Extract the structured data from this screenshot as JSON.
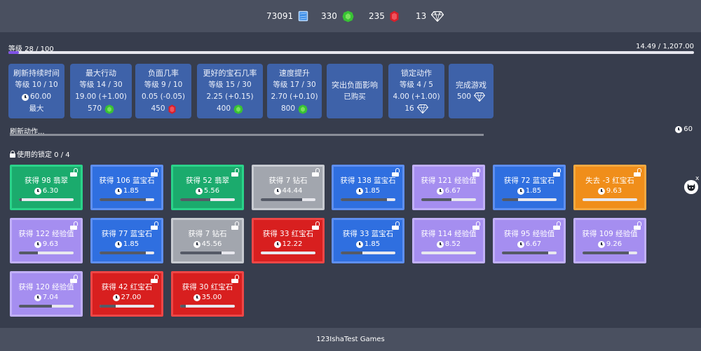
{
  "resources": [
    {
      "name": "time-crystal",
      "value": "73091",
      "color": "#3f8fe8",
      "icon": "blue-gem-icon"
    },
    {
      "name": "emerald",
      "value": "330",
      "color": "#38c234",
      "icon": "green-gem-icon"
    },
    {
      "name": "ruby",
      "value": "235",
      "color": "#d81f2a",
      "icon": "red-gem-icon"
    },
    {
      "name": "diamond",
      "value": "13",
      "color": "#ffffff",
      "icon": "diamond-icon"
    }
  ],
  "level": {
    "label": "等级 28 / 100",
    "progress_text": "14.49 / 1,207.00",
    "progress_fraction": 0.012
  },
  "upgrades": [
    {
      "title": "刷新持续时间",
      "level": "等级 10 / 10",
      "value": "60.00",
      "cost": "最大",
      "cost_icon": "",
      "value_has_clock": true
    },
    {
      "title": "最大行动",
      "level": "等级 14 / 30",
      "value": "19.00 (+1.00)",
      "cost": "570",
      "cost_icon": "green-gem-icon"
    },
    {
      "title": "负面几率",
      "level": "等级 9 / 10",
      "value": "0.05 (-0.05)",
      "cost": "450",
      "cost_icon": "red-gem-icon"
    },
    {
      "title": "更好的宝石几率",
      "level": "等级 15 / 30",
      "value": "2.25 (+0.15)",
      "cost": "400",
      "cost_icon": "green-gem-icon"
    },
    {
      "title": "速度提升",
      "level": "等级 17 / 30",
      "value": "2.70 (+0.10)",
      "cost": "800",
      "cost_icon": "green-gem-icon"
    },
    {
      "title": "突出负面影响",
      "level": "已购买",
      "value": "",
      "cost": "",
      "cost_icon": ""
    },
    {
      "title": "锁定动作",
      "level": "等级 4 / 5",
      "value": "4.00 (+1.00)",
      "cost": "16",
      "cost_icon": "diamond-icon"
    },
    {
      "title": "完成游戏",
      "level": "",
      "value": "",
      "cost": "500",
      "cost_icon": "diamond-icon"
    }
  ],
  "refresh": {
    "label": "刷新动作...",
    "time": "60",
    "progress_fraction": 0.0
  },
  "locks_used": "使用的锁定 0 / 4",
  "actions": [
    {
      "label": "获得 98 翡翠",
      "time": "6.30",
      "color": "green",
      "progress": 0.05
    },
    {
      "label": "获得 106 蓝宝石",
      "time": "1.85",
      "color": "blue",
      "progress": 0.85
    },
    {
      "label": "获得 52 翡翠",
      "time": "5.56",
      "color": "green",
      "progress": 0.55
    },
    {
      "label": "获得 7 钻石",
      "time": "44.44",
      "color": "gray",
      "progress": 0.75
    },
    {
      "label": "获得 138 蓝宝石",
      "time": "1.85",
      "color": "blue",
      "progress": 0.85
    },
    {
      "label": "获得 121 经验值",
      "time": "6.67",
      "color": "purple",
      "progress": 0.55
    },
    {
      "label": "获得 72 蓝宝石",
      "time": "1.85",
      "color": "blue",
      "progress": 0.3
    },
    {
      "label": "失去 -3 红宝石",
      "time": "9.63",
      "color": "orange",
      "progress": 0.0
    },
    {
      "label": "获得 122 经验值",
      "time": "9.63",
      "color": "purple",
      "progress": 0.35
    },
    {
      "label": "获得 77 蓝宝石",
      "time": "1.85",
      "color": "blue",
      "progress": 0.85
    },
    {
      "label": "获得 7 钻石",
      "time": "45.56",
      "color": "gray",
      "progress": 0.75
    },
    {
      "label": "获得 33 红宝石",
      "time": "12.22",
      "color": "red",
      "progress": 0.0
    },
    {
      "label": "获得 33 蓝宝石",
      "time": "1.85",
      "color": "blue",
      "progress": 0.4
    },
    {
      "label": "获得 114 经验值",
      "time": "8.52",
      "color": "purple",
      "progress": 0.0
    },
    {
      "label": "获得 95 经验值",
      "time": "6.67",
      "color": "purple",
      "progress": 0.85
    },
    {
      "label": "获得 109 经验值",
      "time": "9.26",
      "color": "purple",
      "progress": 0.85
    },
    {
      "label": "获得 120 经验值",
      "time": "7.04",
      "color": "purple",
      "progress": 0.6
    },
    {
      "label": "获得 42 红宝石",
      "time": "27.00",
      "color": "red",
      "progress": 0.3
    },
    {
      "label": "获得 30 红宝石",
      "time": "35.00",
      "color": "red",
      "progress": 0.1
    }
  ],
  "side": {
    "close_label": "x",
    "avatar_icon": "github-cat-icon"
  },
  "footer": "123IshaTest Games"
}
